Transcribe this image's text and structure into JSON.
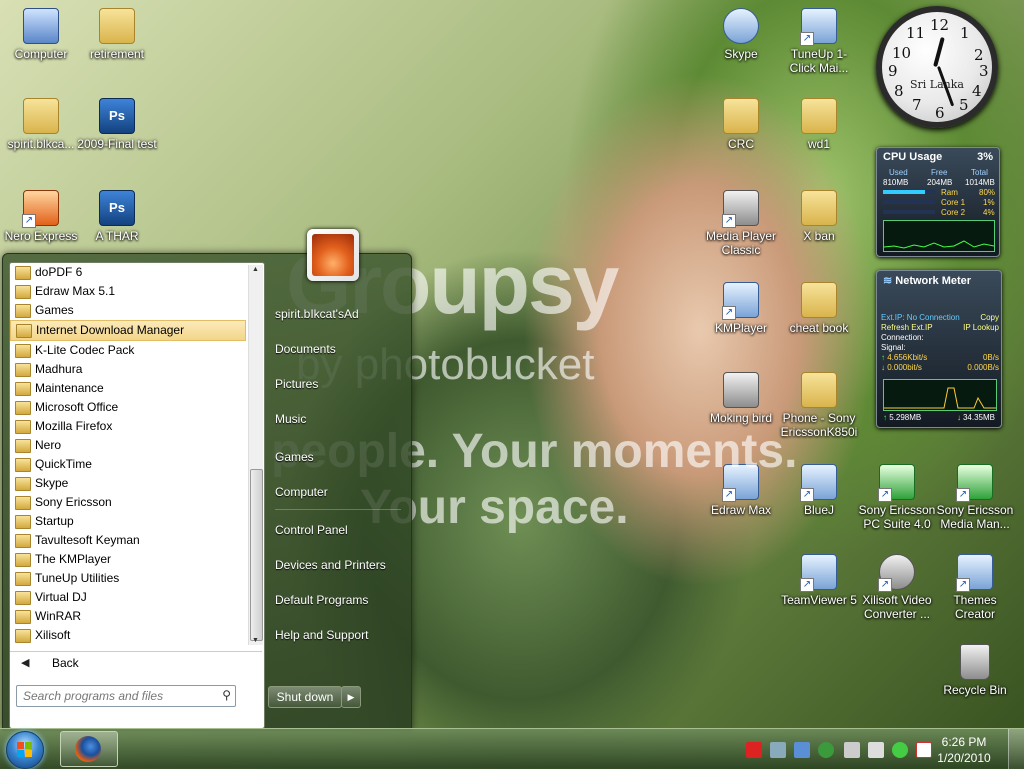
{
  "desktop_icons": [
    {
      "label": "Computer",
      "type": "pc"
    },
    {
      "label": "retirement",
      "type": "folder"
    },
    {
      "label": "spirit.blkca...",
      "type": "folder"
    },
    {
      "label": "2009-Final test",
      "type": "psd"
    },
    {
      "label": "Nero Express",
      "type": "orange-shortcut"
    },
    {
      "label": "A THAR",
      "type": "psd"
    },
    {
      "label": "Skype",
      "type": "app"
    },
    {
      "label": "TuneUp 1-Click Mai...",
      "type": "app-shortcut"
    },
    {
      "label": "CRC",
      "type": "folder"
    },
    {
      "label": "wd1",
      "type": "folder"
    },
    {
      "label": "Media Player Classic",
      "type": "app-shortcut"
    },
    {
      "label": "X ban",
      "type": "folder"
    },
    {
      "label": "KMPlayer",
      "type": "app-shortcut"
    },
    {
      "label": "cheat book",
      "type": "folder"
    },
    {
      "label": "Moking bird",
      "type": "file"
    },
    {
      "label": "Phone - Sony EricssonK850i",
      "type": "folder"
    },
    {
      "label": "Edraw Max",
      "type": "app-shortcut"
    },
    {
      "label": "BlueJ",
      "type": "app-shortcut"
    },
    {
      "label": "Sony Ericsson PC Suite 4.0",
      "type": "green-shortcut"
    },
    {
      "label": "Sony Ericsson Media Man...",
      "type": "green-shortcut"
    },
    {
      "label": "TeamViewer 5",
      "type": "app-shortcut"
    },
    {
      "label": "Xilisoft Video Converter ...",
      "type": "gray-shortcut"
    },
    {
      "label": "Themes Creator",
      "type": "app-shortcut"
    },
    {
      "label": "Recycle Bin",
      "type": "gray"
    }
  ],
  "watermark": {
    "brand": "Groupsy",
    "by": "by photobucket",
    "line1": "Your people. Your moments.",
    "line2": "Your space."
  },
  "clock_gadget": {
    "place": "Sri Lanka",
    "numbers": [
      "12",
      "1",
      "2",
      "3",
      "4",
      "5",
      "6",
      "7",
      "8",
      "9",
      "10",
      "11"
    ]
  },
  "cpu_gadget": {
    "title": "CPU Usage",
    "percent": "3%",
    "headers": [
      "Used",
      "Free",
      "Total"
    ],
    "values": [
      "810MB",
      "204MB",
      "1014MB"
    ],
    "rows": [
      {
        "label": "Ram",
        "value": "80%"
      },
      {
        "label": "Core 1",
        "value": "1%"
      },
      {
        "label": "Core 2",
        "value": "4%"
      }
    ]
  },
  "network_gadget": {
    "title": "Network Meter",
    "ext_ip": "Ext.IP: No Connection",
    "copy": "Copy",
    "refresh": "Refresh Ext.IP",
    "ip_lookup": "IP Lookup",
    "connection": "Connection:",
    "signal": "Signal:",
    "up_rate": "4.656Kbit/s",
    "down_rate": "0.000bit/s",
    "up_rate2": "0B/s",
    "down_rate2": "0.000B/s",
    "total_up": "5.298MB",
    "total_down": "34.35MB"
  },
  "start_menu": {
    "programs": [
      "doPDF 6",
      "Edraw Max 5.1",
      "Games",
      "Internet Download Manager",
      "K-Lite Codec Pack",
      "Madhura",
      "Maintenance",
      "Microsoft Office",
      "Mozilla Firefox",
      "Nero",
      "QuickTime",
      "Skype",
      "Sony Ericsson",
      "Startup",
      "Tavultesoft Keyman",
      "The KMPlayer",
      "TuneUp Utilities",
      "Virtual DJ",
      "WinRAR",
      "Xilisoft"
    ],
    "selected_index": 3,
    "back_label": "Back",
    "search_placeholder": "Search programs and files",
    "right_items": {
      "user": "spirit.bIkcat'sAd",
      "documents": "Documents",
      "pictures": "Pictures",
      "music": "Music",
      "games": "Games",
      "computer": "Computer",
      "control_panel": "Control Panel",
      "devices": "Devices and Printers",
      "default_programs": "Default Programs",
      "help": "Help and Support"
    },
    "shutdown_label": "Shut down",
    "shutdown_arrow": "▶"
  },
  "taskbar": {
    "time": "6:26 PM",
    "date": "1/20/2010",
    "pinned": [
      "Firefox"
    ],
    "tray_icons": [
      "alert-icon",
      "network-settings-icon",
      "update-icon",
      "sync-icon",
      "network-icon",
      "volume-icon",
      "skype-status-icon",
      "action-center-icon"
    ]
  },
  "colors": {
    "accent": "#3a86d1",
    "selection": "#f3d58a",
    "menu": "#3c552d"
  }
}
